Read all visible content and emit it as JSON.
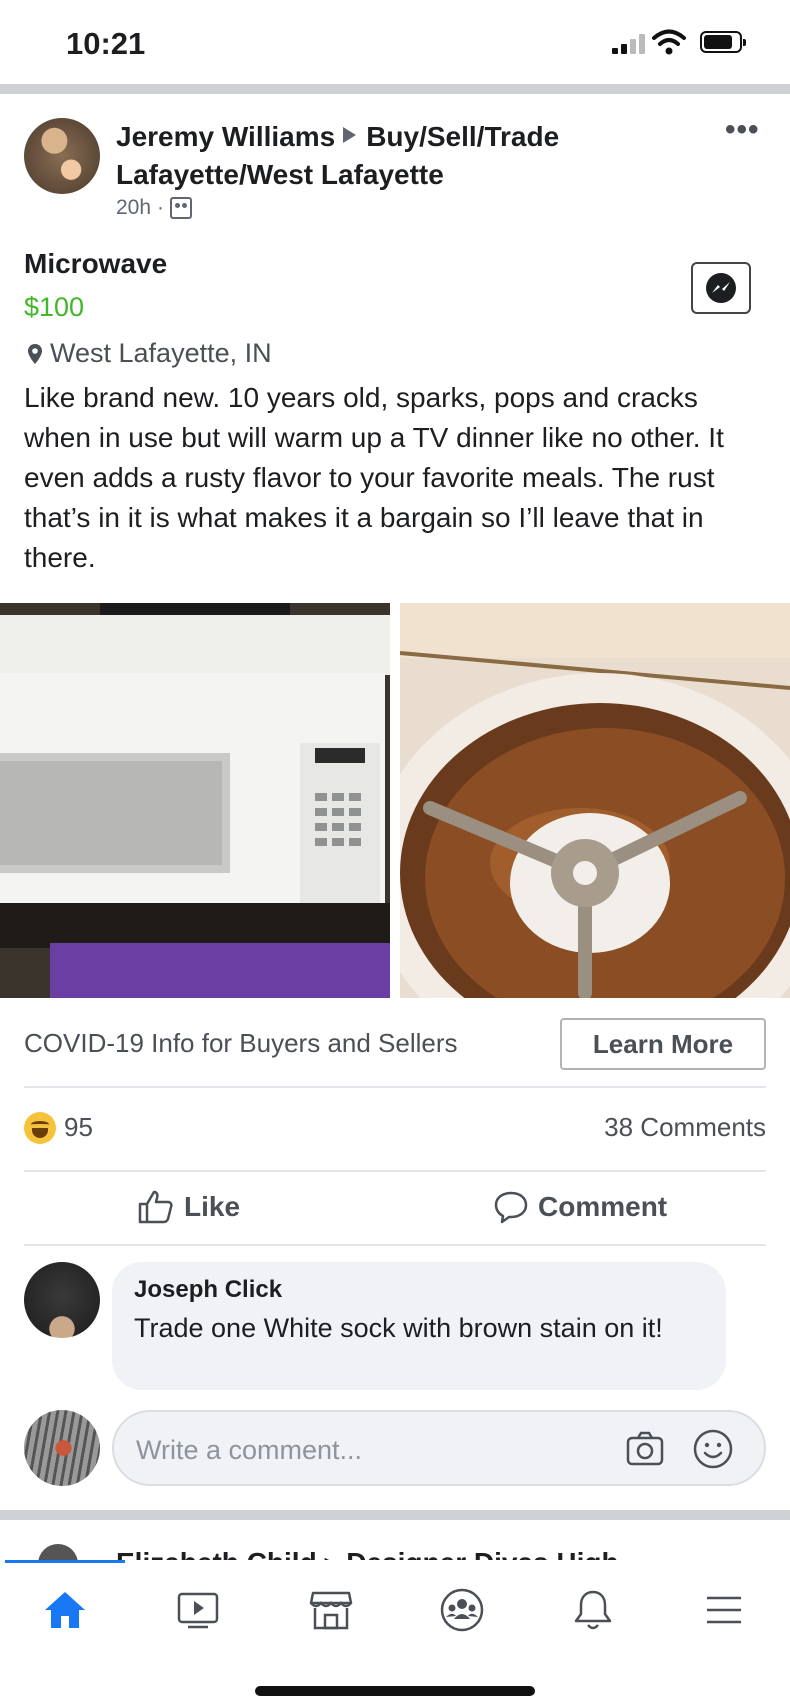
{
  "status_bar": {
    "time": "10:21"
  },
  "post": {
    "author": "Jeremy Williams",
    "group": "Buy/Sell/Trade Lafayette/West Lafayette",
    "time_ago": "20h",
    "item_title": "Microwave",
    "price": "$100",
    "location": "West Lafayette, IN",
    "description": "Like brand new. 10 years old, sparks, pops and cracks when in use but will warm up a TV dinner like no other. It even adds a rusty flavor to your favorite meals. The rust that’s in it is what makes it a bargain so I’ll leave that in there."
  },
  "covid": {
    "text": "COVID-19 Info for Buyers and Sellers",
    "button": "Learn More"
  },
  "reactions": {
    "count": "95",
    "comments": "38 Comments"
  },
  "actions": {
    "like": "Like",
    "comment": "Comment"
  },
  "comment": {
    "author": "Joseph Click",
    "text": "Trade one White sock with brown stain on it!"
  },
  "comment_input": {
    "placeholder": "Write a comment..."
  },
  "next_post": {
    "peek_text": "Elizabeth Child ▸ Designer Divas High"
  },
  "colors": {
    "price_green": "#42b72a",
    "brand_blue": "#1877f2"
  },
  "tabs": [
    "home-icon",
    "watch-icon",
    "marketplace-icon",
    "groups-icon",
    "notifications-icon",
    "menu-icon"
  ]
}
